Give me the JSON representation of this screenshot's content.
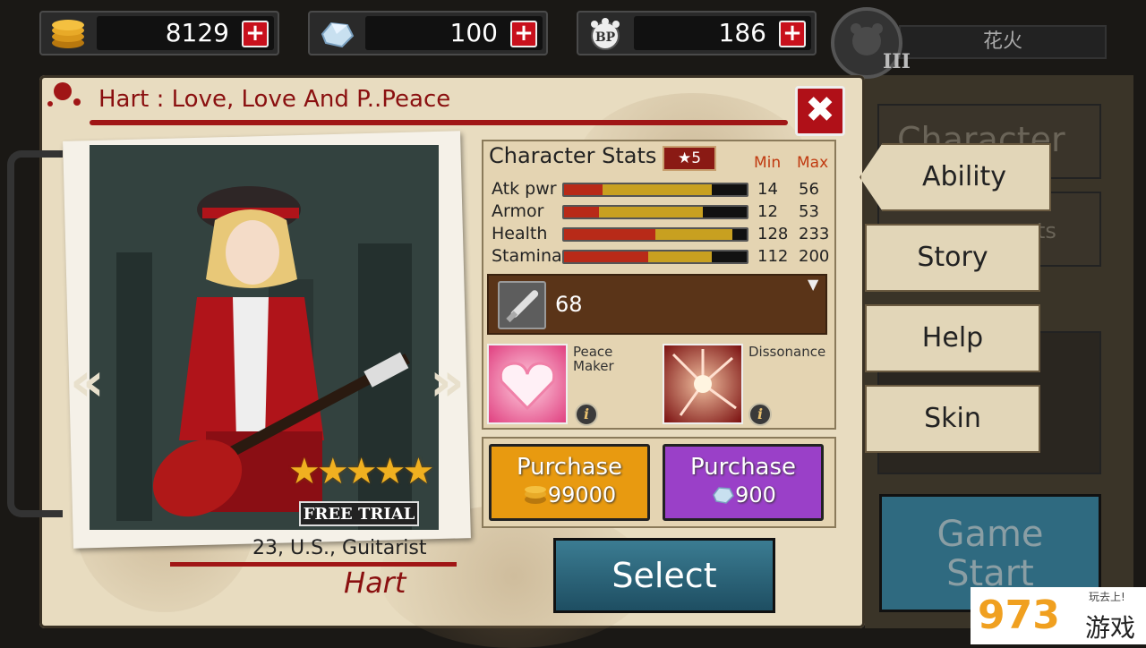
{
  "currency": {
    "gold": {
      "value": "8129",
      "icon": "gold-coins-icon"
    },
    "gems": {
      "value": "100",
      "icon": "crystal-icon"
    },
    "bp": {
      "value": "186",
      "icon": "bp-paw-icon",
      "badge": "BP"
    },
    "plus_label": "+"
  },
  "player": {
    "name": "花火",
    "rank": "III"
  },
  "dialog": {
    "title": "Hart : Love, Love And P..Peace",
    "close_label": "✖"
  },
  "character": {
    "rarity_stars": "★★★★★",
    "trial_label": "FREE TRIAL",
    "info": "23, U.S., Guitarist",
    "name": "Hart",
    "prev_arrow": "«",
    "next_arrow": "»"
  },
  "stats": {
    "title": "Character Stats",
    "rank_badge": "★5",
    "min_label": "Min",
    "max_label": "Max",
    "rows": [
      {
        "label": "Atk pwr",
        "min": "14",
        "max": "56",
        "min_frac": 0.21,
        "max_frac": 0.81
      },
      {
        "label": "Armor",
        "min": "12",
        "max": "53",
        "min_frac": 0.19,
        "max_frac": 0.76
      },
      {
        "label": "Health",
        "min": "128",
        "max": "233",
        "min_frac": 0.5,
        "max_frac": 0.92
      },
      {
        "label": "Stamina",
        "min": "112",
        "max": "200",
        "min_frac": 0.46,
        "max_frac": 0.81
      }
    ]
  },
  "weapon": {
    "value": "68",
    "icon": "baseball-bat-icon",
    "dropdown": "▼"
  },
  "skills": [
    {
      "name_line1": "Peace",
      "name_line2": "Maker",
      "info": "i"
    },
    {
      "name_line1": "Dissonance",
      "name_line2": "",
      "info": "i"
    }
  ],
  "purchase": {
    "label": "Purchase",
    "gold_price": "99000",
    "gem_price": "900",
    "gold_icon": "gold-coins-icon",
    "gem_icon": "crystal-icon",
    "gold_color": "#e89a10",
    "gem_color": "#9a40c8"
  },
  "select_label": "Select",
  "side_menu": {
    "character_tab": "Character",
    "achievements_tab": "ents",
    "items": [
      "Ability",
      "Story",
      "Help",
      "Skin"
    ],
    "game_start_line1": "Game",
    "game_start_line2": "Start"
  },
  "watermark": {
    "digits": "973",
    "text": "游戏",
    "tag": "玩去上!"
  }
}
